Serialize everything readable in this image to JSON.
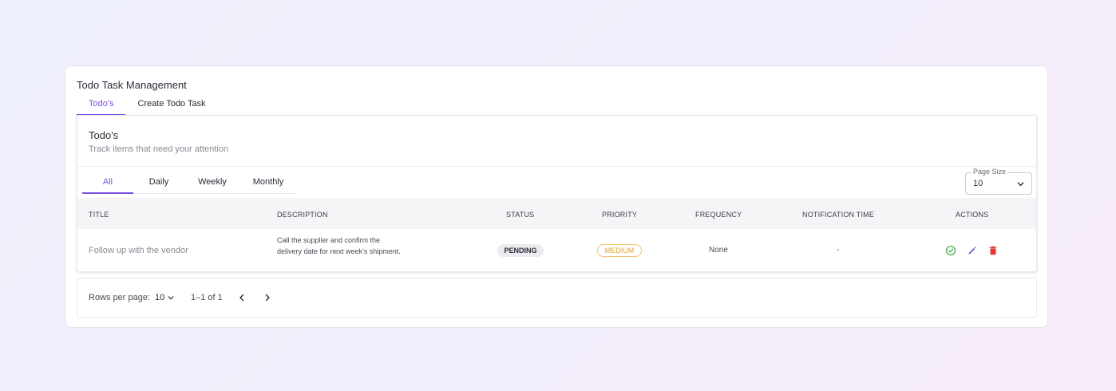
{
  "app": {
    "title": "Todo Task Management"
  },
  "top_tabs": [
    {
      "label": "Todo's",
      "active": true
    },
    {
      "label": "Create Todo Task",
      "active": false
    }
  ],
  "panel": {
    "title": "Todo's",
    "subtitle": "Track items that need your attention"
  },
  "filters": [
    {
      "label": "All",
      "active": true
    },
    {
      "label": "Daily",
      "active": false
    },
    {
      "label": "Weekly",
      "active": false
    },
    {
      "label": "Monthly",
      "active": false
    }
  ],
  "page_size": {
    "label": "Page Size",
    "value": "10"
  },
  "table": {
    "columns": [
      "TITLE",
      "DESCRIPTION",
      "STATUS",
      "PRIORITY",
      "FREQUENCY",
      "NOTIFICATION TIME",
      "ACTIONS"
    ],
    "rows": [
      {
        "title": "Follow up with the vendor",
        "description": "Call the supplier and confirm the delivery date for next week's shipment.",
        "status": "PENDING",
        "priority": "MEDIUM",
        "frequency": "None",
        "notification_time": "-",
        "actions": [
          "check-circle-icon",
          "pencil-icon",
          "trash-icon"
        ]
      }
    ]
  },
  "pagination": {
    "rows_per_page_label": "Rows per page:",
    "rows_per_page_value": "10",
    "range": "1–1 of 1"
  },
  "colors": {
    "accent": "#7b4fe0",
    "complete": "#4caf50",
    "edit": "#7b4fe0",
    "delete": "#e53935",
    "medium": "#e2a52b"
  }
}
